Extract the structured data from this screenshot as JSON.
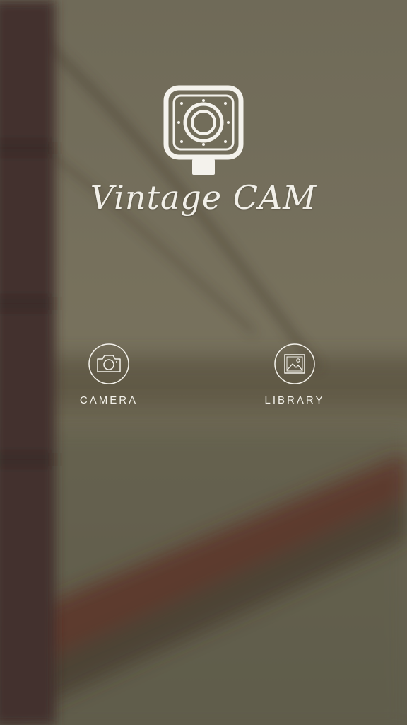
{
  "app": {
    "title": "Vintage CAM"
  },
  "icons": {
    "logo": "vintage-camera-logo-icon",
    "camera": "camera-icon",
    "library": "photo-library-icon"
  },
  "actions": {
    "camera_label": "CAMERA",
    "library_label": "LIBRARY"
  },
  "colors": {
    "foreground": "#f3f1ea",
    "background_tint": "#6f6a57",
    "bridge": "#4a2424"
  }
}
